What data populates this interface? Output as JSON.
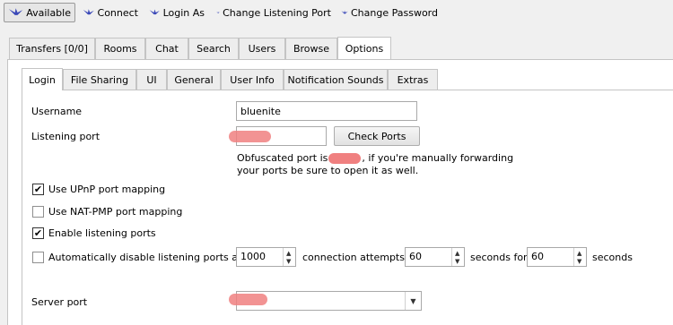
{
  "toolbar": {
    "items": [
      {
        "label": "Available",
        "icon": "bird-icon"
      },
      {
        "label": "Connect",
        "icon": "bird-icon"
      },
      {
        "label": "Login As",
        "icon": "bird-icon"
      },
      {
        "label": "Change Listening Port",
        "icon": "bird-icon"
      },
      {
        "label": "Change Password",
        "icon": "bird-icon"
      }
    ]
  },
  "main_tabs": [
    "Transfers [0/0]",
    "Rooms",
    "Chat",
    "Search",
    "Users",
    "Browse",
    "Options"
  ],
  "options_tabs": [
    "Login",
    "File Sharing",
    "UI",
    "General",
    "User Info",
    "Notification Sounds",
    "Extras"
  ],
  "login": {
    "username_label": "Username",
    "username_value": "bluenite",
    "listening_port_label": "Listening port",
    "check_ports_label": "Check Ports",
    "obfuscated_line1_pre": "Obfuscated port is",
    "obfuscated_line1_post": ", if you're manually forwarding",
    "obfuscated_line2": "your ports be sure to open it as well.",
    "upnp_label": "Use UPnP port mapping",
    "upnp_checked": true,
    "natpmp_label": "Use NAT-PMP port mapping",
    "natpmp_checked": false,
    "enable_listening_label": "Enable listening ports",
    "enable_listening_checked": true,
    "auto_disable_label": "Automatically disable listening ports after",
    "auto_disable_checked": false,
    "attempts_value": "1000",
    "connection_attempts_label": "connection attempts in",
    "seconds_in_value": "60",
    "seconds_for_label": "seconds for",
    "seconds_for_value": "60",
    "seconds_label": "seconds",
    "server_port_label": "Server port"
  },
  "colors": {
    "redaction": "#f08080",
    "icon": "#3b49b8"
  }
}
